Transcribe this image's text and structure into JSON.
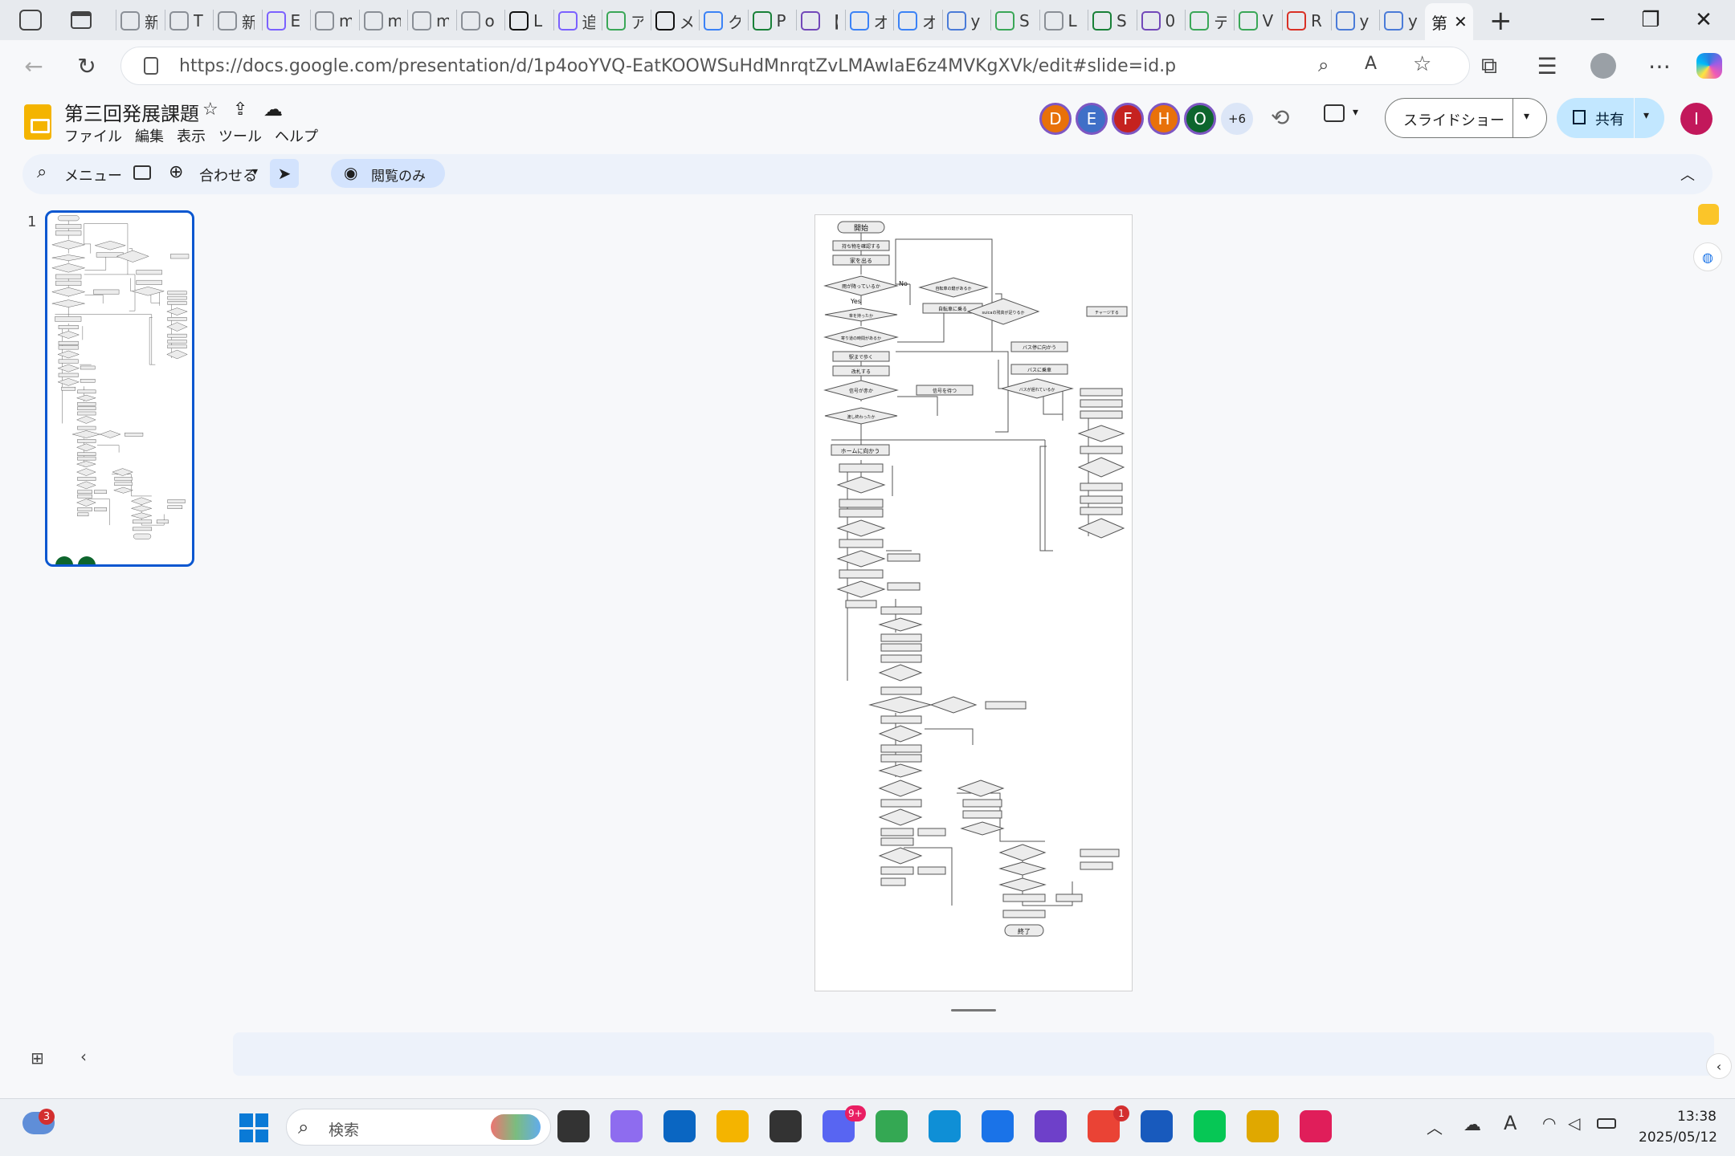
{
  "browser": {
    "tabs": [
      {
        "title": "新",
        "icon": "notes-icon"
      },
      {
        "title": "T",
        "icon": "globe-icon"
      },
      {
        "title": "新",
        "icon": "notes-icon"
      },
      {
        "title": "Ε",
        "icon": "gemini-icon"
      },
      {
        "title": "m",
        "icon": "globe-icon"
      },
      {
        "title": "m",
        "icon": "globe-icon"
      },
      {
        "title": "m",
        "icon": "globe-icon"
      },
      {
        "title": "o",
        "icon": "globe-icon"
      },
      {
        "title": "L",
        "icon": "openai-icon"
      },
      {
        "title": "追",
        "icon": "gemini-icon"
      },
      {
        "title": "ア",
        "icon": "leaf-icon"
      },
      {
        "title": "メ",
        "icon": "openai-icon"
      },
      {
        "title": "ク",
        "icon": "search-icon"
      },
      {
        "title": "P",
        "icon": "sheet-icon"
      },
      {
        "title": "【",
        "icon": "form-icon"
      },
      {
        "title": "オ",
        "icon": "search-icon"
      },
      {
        "title": "オ",
        "icon": "search-icon"
      },
      {
        "title": "y",
        "icon": "folder-icon"
      },
      {
        "title": "S",
        "icon": "leaf-icon"
      },
      {
        "title": "L",
        "icon": "globe-icon"
      },
      {
        "title": "S",
        "icon": "sheet-icon"
      },
      {
        "title": "0",
        "icon": "form-icon"
      },
      {
        "title": "テ",
        "icon": "leaf-icon"
      },
      {
        "title": "V",
        "icon": "leaf-icon"
      },
      {
        "title": "R",
        "icon": "pdf-icon"
      },
      {
        "title": "y",
        "icon": "folder-icon"
      },
      {
        "title": "y",
        "icon": "folder-icon"
      }
    ],
    "active_tab": {
      "title": "第",
      "close": "✕"
    },
    "new_tab": "+",
    "url": "https://docs.google.com/presentation/d/1p4ooYVQ-EatKOOWSuHdMnrqtZvLMAwIaE6z4MVKgXVk/edit#slide=id.p"
  },
  "app": {
    "title": "第三回発展課題",
    "menu": [
      "ファイル",
      "編集",
      "表示",
      "ツール",
      "ヘルプ"
    ],
    "collaborators": [
      {
        "initial": "D",
        "color": "#e8710a"
      },
      {
        "initial": "E",
        "color": "#3f6fc7"
      },
      {
        "initial": "F",
        "color": "#c5221f"
      },
      {
        "initial": "H",
        "color": "#e8710a"
      },
      {
        "initial": "O",
        "color": "#0d652d"
      }
    ],
    "more_collaborators": "+6",
    "slideshow_label": "スライドショー",
    "share_label": "共有",
    "user_initial": "I",
    "user_color": "#c2185b"
  },
  "toolbar": {
    "menu_search": "メニュー",
    "zoom_label": "合わせる",
    "view_only": "閲覧のみ"
  },
  "filmstrip": {
    "slide_number": "1"
  },
  "flowchart": {
    "start": "開始",
    "end": "終了",
    "yes": "Yes",
    "no": "No",
    "steps": [
      "持ち物を確認する",
      "家を出る",
      "雨が降っているか",
      "傘を持ったか",
      "寄り道の時間があるか",
      "駅まで歩く",
      "改札する",
      "信号が赤か",
      "渡し終わったか",
      "ホームに向かう",
      "自転車の鍵があるか",
      "自転車に乗る",
      "信号を待つ",
      "suicaの残高が足りるか",
      "チャージする",
      "バス停に向かう",
      "バスに乗車",
      "バスが遅れているか"
    ]
  },
  "taskbar": {
    "weather_badge": "3",
    "search_placeholder": "検索",
    "discord_badge": "9+",
    "chrome_badge": "1",
    "time": "13:38",
    "date": "2025/05/12"
  }
}
